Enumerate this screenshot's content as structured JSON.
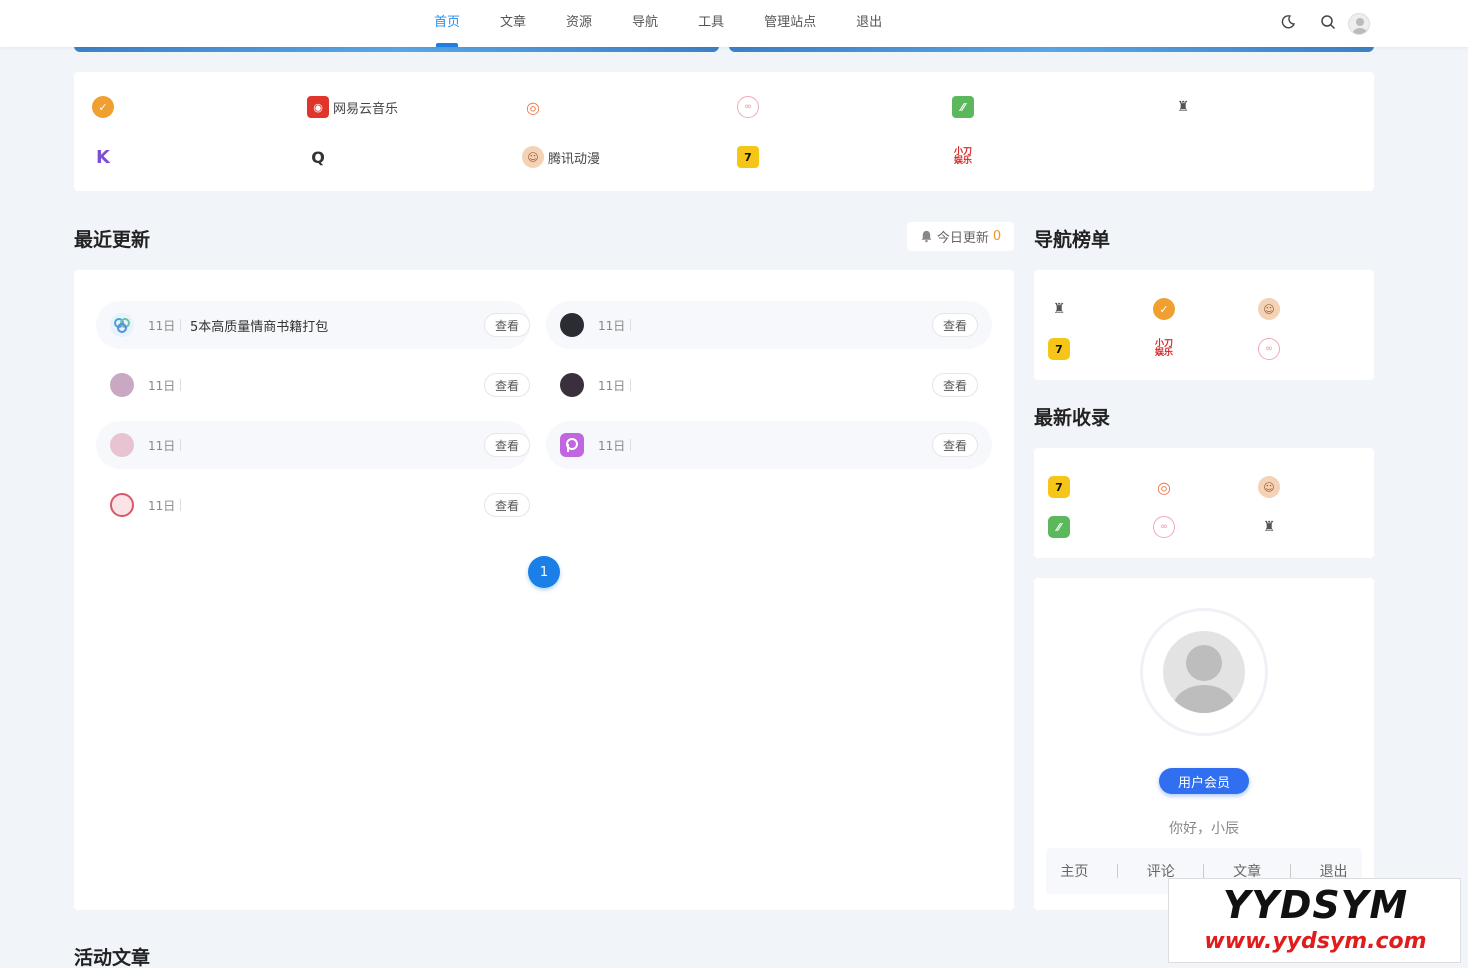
{
  "nav": {
    "items": [
      "首页",
      "文章",
      "资源",
      "导航",
      "工具",
      "管理站点",
      "退出"
    ],
    "active_index": 0
  },
  "icons": {
    "theme": "moon-icon",
    "search": "search-icon",
    "avatar": "user-avatar-icon"
  },
  "links": [
    {
      "label": "",
      "icon": "orange-badge-icon",
      "color": "#f0a030"
    },
    {
      "label": "网易云音乐",
      "icon": "netease-music-icon",
      "color": "#e0352b"
    },
    {
      "label": "",
      "icon": "target-icon",
      "color": "#f07a4a"
    },
    {
      "label": "",
      "icon": "pig-icon",
      "color": "#f2a8b8"
    },
    {
      "label": "",
      "icon": "green-leaf-icon",
      "color": "#5cb85c"
    },
    {
      "label": "",
      "icon": "pixel-character-icon",
      "color": "#555555"
    },
    {
      "label": "",
      "icon": "k-letter-icon",
      "color": "#7b4fd6"
    },
    {
      "label": "",
      "icon": "q-letter-icon",
      "color": "#333333"
    },
    {
      "label": "腾讯动漫",
      "icon": "tencent-comic-icon",
      "color": "#d98b5a"
    },
    {
      "label": "",
      "icon": "seven-cat-icon",
      "color": "#f5c518"
    },
    {
      "label": "",
      "icon": "xiaodao-icon",
      "color": "#d62828"
    }
  ],
  "recent": {
    "title": "最近更新",
    "today_label": "今日更新",
    "today_count": "0",
    "view_label": "查看",
    "items": [
      {
        "date": "11日",
        "title": "5本高质量情商书籍打包",
        "avatar": "#6fb6e8"
      },
      {
        "date": "11日",
        "title": "",
        "avatar": "#2b2b33"
      },
      {
        "date": "11日",
        "title": "",
        "avatar": "#c9a8c4"
      },
      {
        "date": "11日",
        "title": "",
        "avatar": "#3a2f3c"
      },
      {
        "date": "11日",
        "title": "",
        "avatar": "#e8c3d2"
      },
      {
        "date": "11日",
        "title": "",
        "avatar": "#c066e0"
      },
      {
        "date": "11日",
        "title": "",
        "avatar": "#d85a6a"
      }
    ],
    "page": "1"
  },
  "nav_rank": {
    "title": "导航榜单",
    "icons": [
      {
        "icon": "pixel-character-icon",
        "color": "#555555"
      },
      {
        "icon": "orange-badge-icon",
        "color": "#f0a030"
      },
      {
        "icon": "tencent-comic-icon",
        "color": "#d98b5a"
      },
      {
        "icon": "seven-cat-icon",
        "color": "#f5c518"
      },
      {
        "icon": "xiaodao-icon",
        "color": "#d62828"
      },
      {
        "icon": "pig-icon",
        "color": "#f2a8b8"
      }
    ]
  },
  "latest": {
    "title": "最新收录",
    "icons": [
      {
        "icon": "seven-cat-icon",
        "color": "#f5c518"
      },
      {
        "icon": "target-icon",
        "color": "#f07a4a"
      },
      {
        "icon": "tencent-comic-icon",
        "color": "#d98b5a"
      },
      {
        "icon": "green-leaf-icon",
        "color": "#5cb85c"
      },
      {
        "icon": "pig-icon",
        "color": "#f2a8b8"
      },
      {
        "icon": "pixel-character-icon",
        "color": "#555555"
      }
    ]
  },
  "profile": {
    "member_label": "用户会员",
    "greeting": "你好，小辰",
    "links": [
      "主页",
      "评论",
      "文章",
      "退出"
    ]
  },
  "active_articles": {
    "title": "活动文章"
  },
  "watermark": {
    "line1": "YYDSYM",
    "line2": "www.yydsym.com"
  }
}
